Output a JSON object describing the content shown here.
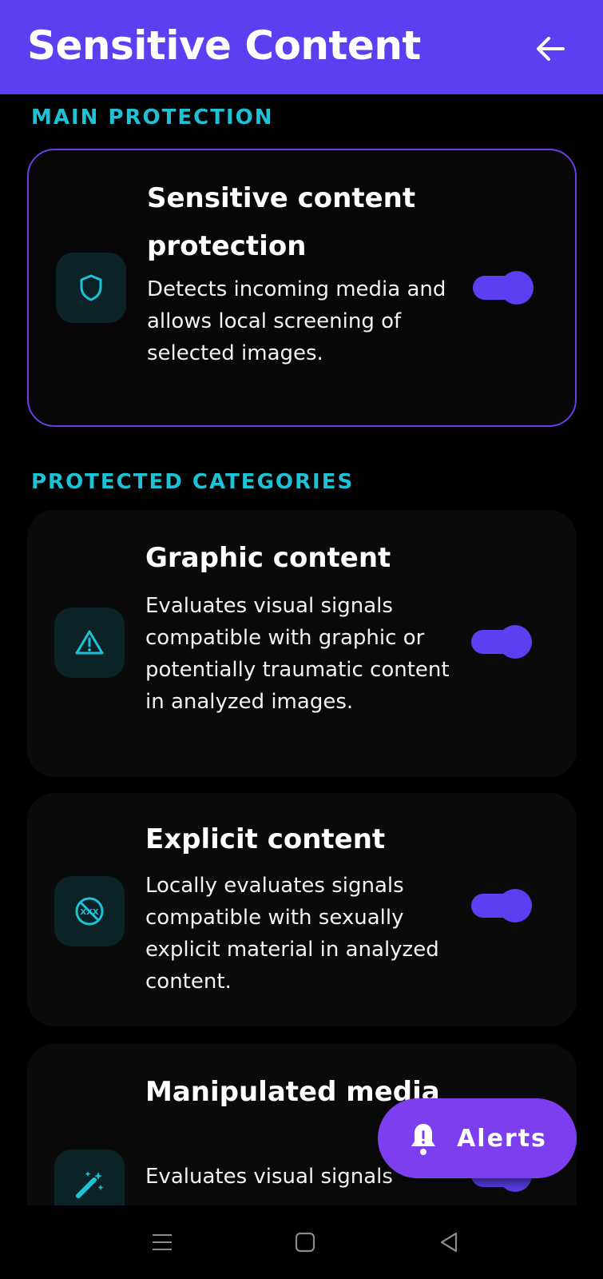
{
  "app_bar": {
    "title": "Sensitive Content",
    "back_icon": "arrow-left-icon"
  },
  "sections": {
    "main": {
      "label": "MAIN PROTECTION"
    },
    "categories": {
      "label": "PROTECTED CATEGORIES"
    }
  },
  "main_card": {
    "title": "Sensitive content protection",
    "description": "Detects incoming media and allows local screening of selected images.",
    "icon": "shield-icon",
    "enabled": true
  },
  "categories": [
    {
      "title": "Graphic content",
      "description": "Evaluates visual signals compatible with graphic or potentially traumatic content in analyzed images.",
      "icon": "warning-triangle-icon",
      "enabled": true
    },
    {
      "title": "Explicit content",
      "description": "Locally evaluates signals compatible with sexually explicit material in analyzed content.",
      "icon": "xxx-blocked-icon",
      "icon_text": "XXX",
      "enabled": true
    },
    {
      "title": "Manipulated media",
      "description": "Evaluates visual signals",
      "icon": "magic-wand-icon",
      "enabled": true
    }
  ],
  "fab": {
    "label": "Alerts",
    "icon": "bell-alert-icon"
  },
  "nav": {
    "menu_icon": "menu-icon",
    "home_icon": "home-square-icon",
    "back_icon": "back-triangle-icon"
  },
  "colors": {
    "accent": "#5b3ff0",
    "fab": "#7b3ff0",
    "section_label": "#1ec2d6",
    "icon_color": "#1ec2d6",
    "background": "#000000",
    "card": "#0a0a0a"
  }
}
